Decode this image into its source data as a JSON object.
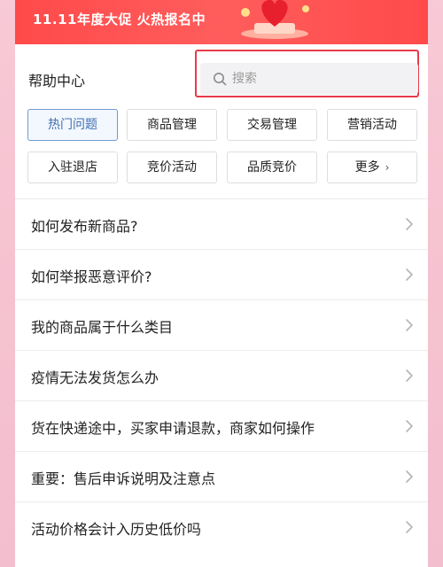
{
  "promo_banner": {
    "text": "11.11年度大促 火热报名中"
  },
  "header": {
    "title": "帮助中心"
  },
  "search": {
    "placeholder": "搜索"
  },
  "tabs": [
    {
      "label": "热门问题",
      "active": true
    },
    {
      "label": "商品管理",
      "active": false
    },
    {
      "label": "交易管理",
      "active": false
    },
    {
      "label": "营销活动",
      "active": false
    },
    {
      "label": "入驻退店",
      "active": false
    },
    {
      "label": "竞价活动",
      "active": false
    },
    {
      "label": "品质竞价",
      "active": false
    },
    {
      "label": "更多",
      "active": false
    }
  ],
  "faq": [
    {
      "question": "如何发布新商品?"
    },
    {
      "question": "如何举报恶意评价?"
    },
    {
      "question": "我的商品属于什么类目"
    },
    {
      "question": "疫情无法发货怎么办"
    },
    {
      "question": "货在快递途中，买家申请退款，商家如何操作"
    },
    {
      "question": "重要：售后申诉说明及注意点"
    },
    {
      "question": "活动价格会计入历史低价吗"
    }
  ],
  "colors": {
    "accent": "#3f6fb0",
    "highlight": "#e83a4a",
    "banner": "#ff4a4a"
  }
}
